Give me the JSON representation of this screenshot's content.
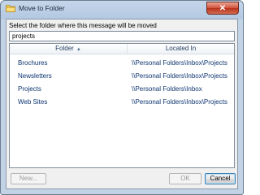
{
  "window": {
    "title": "Move to Folder",
    "close_glyph": "✕"
  },
  "dialog": {
    "prompt": "Select the folder where this message will be moved",
    "search_value": "projects"
  },
  "table": {
    "columns": [
      "Folder",
      "Located In"
    ],
    "sort_indicator": "▲",
    "rows": [
      {
        "folder": "Brochures",
        "location": "\\\\Personal Folders\\Inbox\\Projects"
      },
      {
        "folder": "Newsletters",
        "location": "\\\\Personal Folders\\Inbox\\Projects"
      },
      {
        "folder": "Projects",
        "location": "\\\\Personal Folders\\Inbox"
      },
      {
        "folder": "Web Sites",
        "location": "\\\\Personal Folders\\Inbox\\Projects"
      }
    ]
  },
  "buttons": {
    "new": "New...",
    "ok": "OK",
    "cancel": "Cancel"
  },
  "icons": {
    "title": "folder-icon",
    "close": "close-icon"
  },
  "colors": {
    "row_text": "#0d3670",
    "header_text": "#1e395b",
    "close_button": "#c9452e"
  }
}
